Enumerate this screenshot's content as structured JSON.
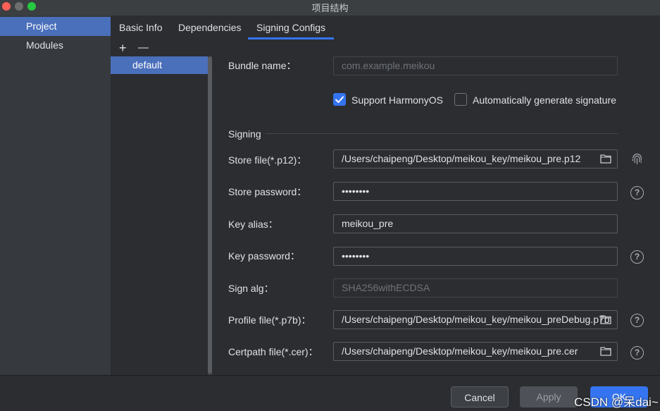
{
  "window": {
    "title": "项目结构"
  },
  "nav": {
    "items": [
      {
        "label": "Project",
        "active": true
      },
      {
        "label": "Modules",
        "active": false
      }
    ]
  },
  "tabs": [
    {
      "label": "Basic Info",
      "active": false
    },
    {
      "label": "Dependencies",
      "active": false
    },
    {
      "label": "Signing Configs",
      "active": true
    }
  ],
  "configs": {
    "add": "+",
    "remove": "—",
    "items": [
      "default"
    ]
  },
  "form": {
    "bundle_name_label": "Bundle name：",
    "bundle_name_placeholder": "com.example.meikou",
    "support_harmonyos_label": "Support HarmonyOS",
    "support_harmonyos_checked": true,
    "auto_sign_label": "Automatically generate signature",
    "auto_sign_checked": false,
    "signing_section": "Signing",
    "store_file_label": "Store file(*.p12)：",
    "store_file_value": "/Users/chaipeng/Desktop/meikou_key/meikou_pre.p12",
    "store_password_label": "Store password：",
    "store_password_value": "••••••••",
    "key_alias_label": "Key alias：",
    "key_alias_value": "meikou_pre",
    "key_password_label": "Key password：",
    "key_password_value": "••••••••",
    "sign_alg_label": "Sign alg：",
    "sign_alg_value": "SHA256withECDSA",
    "profile_file_label": "Profile file(*.p7b)：",
    "profile_file_value": "/Users/chaipeng/Desktop/meikou_key/meikou_preDebug.p7b",
    "certpath_file_label": "Certpath file(*.cer)：",
    "certpath_file_value": "/Users/chaipeng/Desktop/meikou_key/meikou_pre.cer",
    "help_glyph": "?"
  },
  "footer": {
    "cancel": "Cancel",
    "apply": "Apply",
    "ok": "OK"
  },
  "watermark": "CSDN @呆dai~",
  "colors": {
    "accent": "#3574f0",
    "selection": "#4a6fbb",
    "background": "#2b2d30",
    "sidebar": "#363a3e"
  }
}
